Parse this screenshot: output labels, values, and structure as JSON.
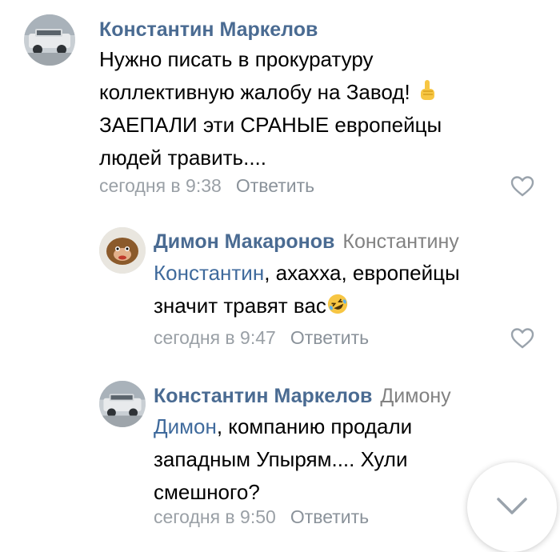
{
  "comments": [
    {
      "author": "Константин Маркелов",
      "lines": [
        "Нужно писать в прокуратуру",
        "коллективную жалобу на Завод!",
        "ЗАЕПАЛИ эти СРАНЫЕ европейцы",
        "людей травить...."
      ],
      "emoji": "pointing-up-emoji",
      "time": "сегодня в 9:38",
      "reply_label": "Ответить"
    },
    {
      "author": "Димон Макаронов",
      "reply_to": "Константину",
      "mention": "Константин",
      "line1_rest": ", ахахха, европейцы",
      "line2": "значит травят вас",
      "emoji": "rolling-laughing-emoji",
      "time": "сегодня в 9:47",
      "reply_label": "Ответить"
    },
    {
      "author": "Константин Маркелов",
      "reply_to": "Димону",
      "mention": "Димон",
      "line1_rest": ", компанию продали",
      "line2": "западным Упырям.... Хули",
      "line3": "смешного?",
      "time": "сегодня в 9:50",
      "reply_label": "Ответить"
    }
  ],
  "icons": {
    "like": "heart-outline-icon",
    "scroll_down": "chevron-down-icon"
  },
  "colors": {
    "author": "#4a6b92",
    "mention": "#3f6a9c",
    "meta": "#9aa0a6"
  }
}
